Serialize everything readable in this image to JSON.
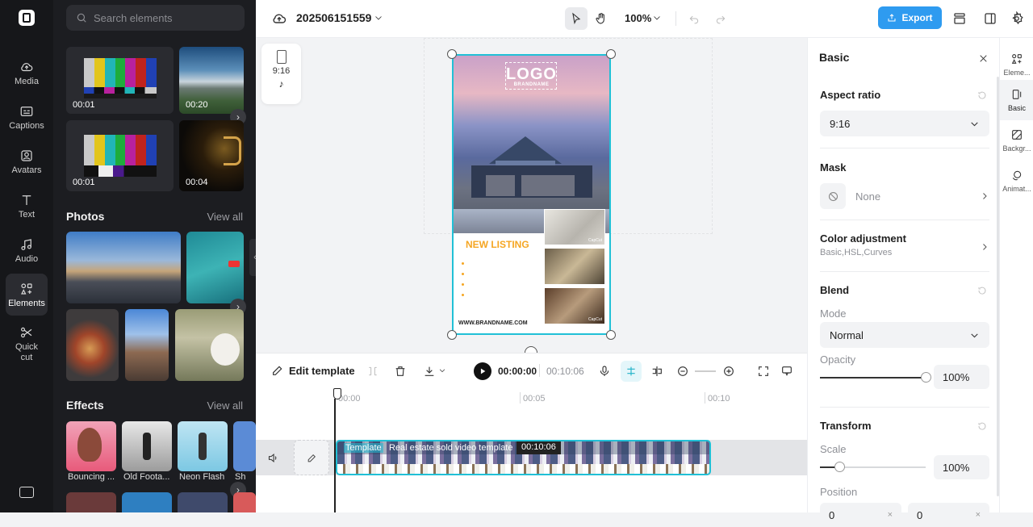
{
  "project": {
    "name": "202506151559"
  },
  "toolbar": {
    "zoom": "100%",
    "export_label": "Export"
  },
  "rail": {
    "items": [
      {
        "label": "Media",
        "icon": "cloud-upload-icon"
      },
      {
        "label": "Captions",
        "icon": "captions-icon"
      },
      {
        "label": "Avatars",
        "icon": "avatar-icon"
      },
      {
        "label": "Text",
        "icon": "text-icon"
      },
      {
        "label": "Audio",
        "icon": "music-note-icon"
      },
      {
        "label": "Elements",
        "icon": "elements-icon"
      },
      {
        "label": "Quick cut",
        "icon": "quick-cut-icon"
      }
    ]
  },
  "library": {
    "search_placeholder": "Search elements",
    "videos": [
      {
        "duration": "00:01"
      },
      {
        "duration": "00:20"
      },
      {
        "duration": "00:01"
      },
      {
        "duration": "00:04"
      }
    ],
    "photos_title": "Photos",
    "photos_viewall": "View all",
    "effects_title": "Effects",
    "effects_viewall": "View all",
    "effects": [
      {
        "label": "Bouncing ..."
      },
      {
        "label": "Old Foota..."
      },
      {
        "label": "Neon Flash"
      },
      {
        "label": "Sh"
      }
    ]
  },
  "canvas": {
    "ratio_badge": "9:16",
    "poster": {
      "logo": "LOGO",
      "brandname": "BRANDNAME",
      "headline": "NEW LISTING",
      "website": "WWW.BRANDNAME.COM",
      "watermark": "CapCut"
    }
  },
  "edit": {
    "edit_template_label": "Edit template",
    "current_time": "00:00:00",
    "total_time": "00:10:06"
  },
  "timeline": {
    "ticks": [
      "00:00",
      "00:05",
      "00:10"
    ],
    "clip_tag": "Template",
    "clip_name": "Real estate sold video template",
    "clip_duration": "00:10:06"
  },
  "panel": {
    "title": "Basic",
    "aspect_label": "Aspect ratio",
    "aspect_value": "9:16",
    "mask_label": "Mask",
    "mask_value": "None",
    "color_label": "Color adjustment",
    "color_sub": "Basic,HSL,Curves",
    "blend_label": "Blend",
    "mode_label": "Mode",
    "mode_value": "Normal",
    "opacity_label": "Opacity",
    "opacity_value": "100%",
    "opacity_level": 1.0,
    "transform_label": "Transform",
    "scale_label": "Scale",
    "scale_value": "100%",
    "scale_level": 0.18,
    "position_label": "Position",
    "pos_x": "0",
    "pos_y": "0"
  },
  "right_tabs": [
    {
      "label": "Eleme...",
      "icon": "elements-icon"
    },
    {
      "label": "Basic",
      "icon": "basic-icon"
    },
    {
      "label": "Backgr...",
      "icon": "background-icon"
    },
    {
      "label": "Animat...",
      "icon": "animation-icon"
    }
  ],
  "colors": {
    "accent": "#2e9bf0",
    "selection": "#21c0d6",
    "listing": "#f5a623"
  }
}
